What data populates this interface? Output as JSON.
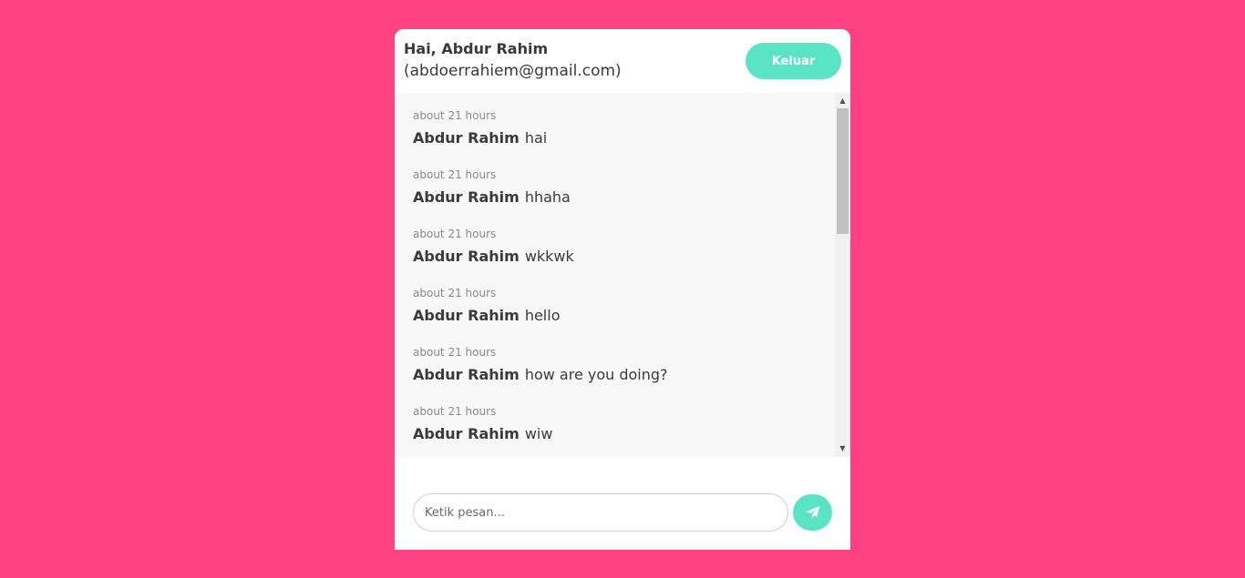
{
  "header": {
    "greeting": "Hai, Abdur Rahim",
    "email": "(abdoerrahiem@gmail.com)",
    "logout_label": "Keluar"
  },
  "messages": [
    {
      "time": "about 21 hours",
      "author": "Abdur Rahim",
      "text": "hai"
    },
    {
      "time": "about 21 hours",
      "author": "Abdur Rahim",
      "text": "hhaha"
    },
    {
      "time": "about 21 hours",
      "author": "Abdur Rahim",
      "text": "wkkwk"
    },
    {
      "time": "about 21 hours",
      "author": "Abdur Rahim",
      "text": "hello"
    },
    {
      "time": "about 21 hours",
      "author": "Abdur Rahim",
      "text": "how are you doing?"
    },
    {
      "time": "about 21 hours",
      "author": "Abdur Rahim",
      "text": "wiw"
    }
  ],
  "composer": {
    "placeholder": "Ketik pesan...",
    "value": "",
    "send_icon": "paper-plane-icon"
  },
  "colors": {
    "background": "#ff4081",
    "accent": "#5ae4c6",
    "message_area": "#f8f8f8"
  }
}
